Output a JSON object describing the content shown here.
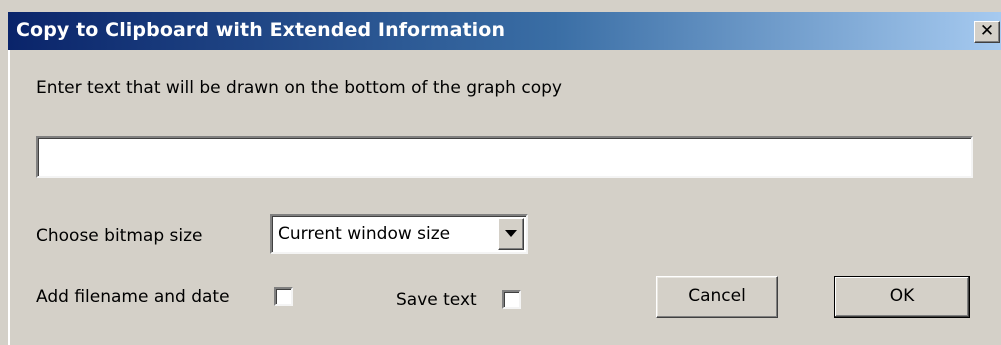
{
  "window": {
    "title": "Copy to Clipboard with Extended Information",
    "close_glyph": "✕",
    "close_icon": "close-icon"
  },
  "form": {
    "prompt_label": "Enter text that will be drawn on the bottom of the graph copy",
    "text_value": "",
    "bitmap_label": "Choose bitmap size",
    "bitmap_selected": "Current window size",
    "add_filename_label": "Add filename and date",
    "add_filename_checked": false,
    "save_text_label": "Save text",
    "save_text_checked": false
  },
  "buttons": {
    "cancel": "Cancel",
    "ok": "OK"
  },
  "colors": {
    "titlebar_start": "#0a246a",
    "titlebar_end": "#a6caf0",
    "dialog_bg": "#d4d0c8"
  }
}
